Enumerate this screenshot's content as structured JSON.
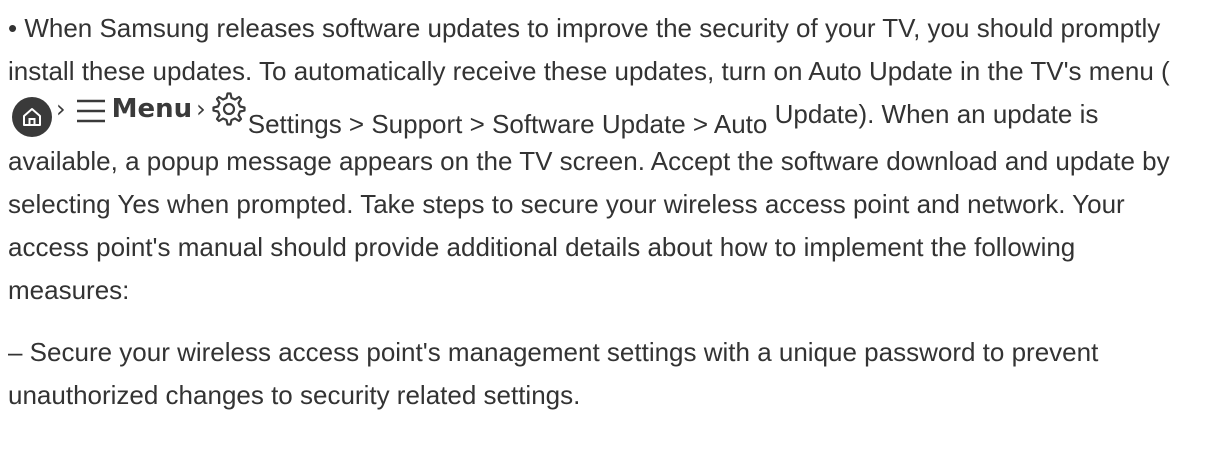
{
  "paragraphs": {
    "p1": {
      "text_before": "• When Samsung releases software updates to improve the security of your TV, you should promptly install these updates. To automatically receive these updates, turn on Auto Update in the TV's menu (",
      "chevron_1": "›",
      "menu_label": "Menu",
      "chevron_2": "›",
      "settings_path": "Settings > Support > Software Update > Auto",
      "text_after": "Update). When an update is available, a popup message appears on the TV screen. Accept the software download and update by selecting Yes when prompted. Take steps to secure your wireless access point and network. Your access point's manual should provide additional details about how to implement the following measures:"
    },
    "p2": {
      "text": "– Secure your wireless access point's management settings with a unique password to prevent unauthorized changes to security related settings."
    }
  },
  "icons": {
    "home": "home-icon",
    "menu": "hamburger-menu-icon",
    "settings": "gear-icon"
  },
  "colors": {
    "text": "#333333",
    "icon": "#3a3a3a",
    "background": "#ffffff"
  }
}
